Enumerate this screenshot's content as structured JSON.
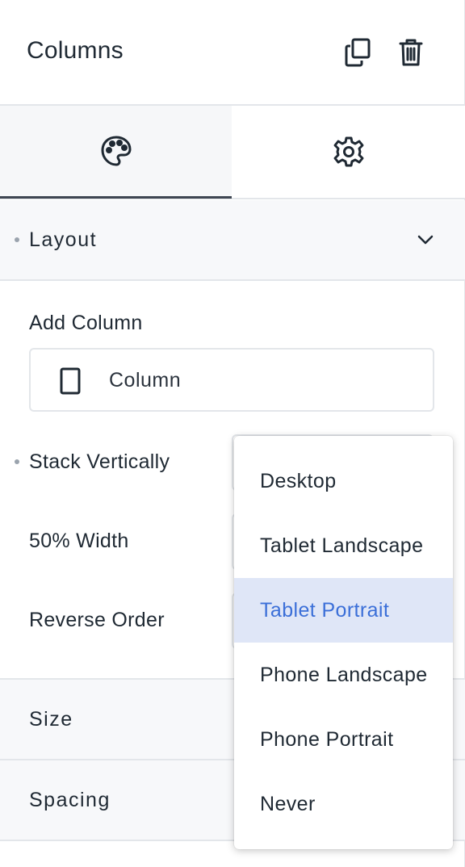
{
  "header": {
    "title": "Columns"
  },
  "tabs": [
    {
      "name": "Style",
      "icon": "palette-icon"
    },
    {
      "name": "Settings",
      "icon": "gear-icon"
    }
  ],
  "layout": {
    "title": "Layout",
    "add_column_label": "Add Column",
    "add_column_button": "Column",
    "stack_vertically_label": "Stack Vertically",
    "width_label": "50% Width",
    "reverse_order_label": "Reverse Order"
  },
  "sections": {
    "size": "Size",
    "spacing": "Spacing"
  },
  "dropdown": {
    "options": [
      "Desktop",
      "Tablet Landscape",
      "Tablet Portrait",
      "Phone Landscape",
      "Phone Portrait",
      "Never"
    ],
    "selected": "Tablet Portrait"
  },
  "colors": {
    "accent": "#3b6fd8",
    "selected_bg": "#dfe6f7",
    "icon": "#1f2933"
  }
}
